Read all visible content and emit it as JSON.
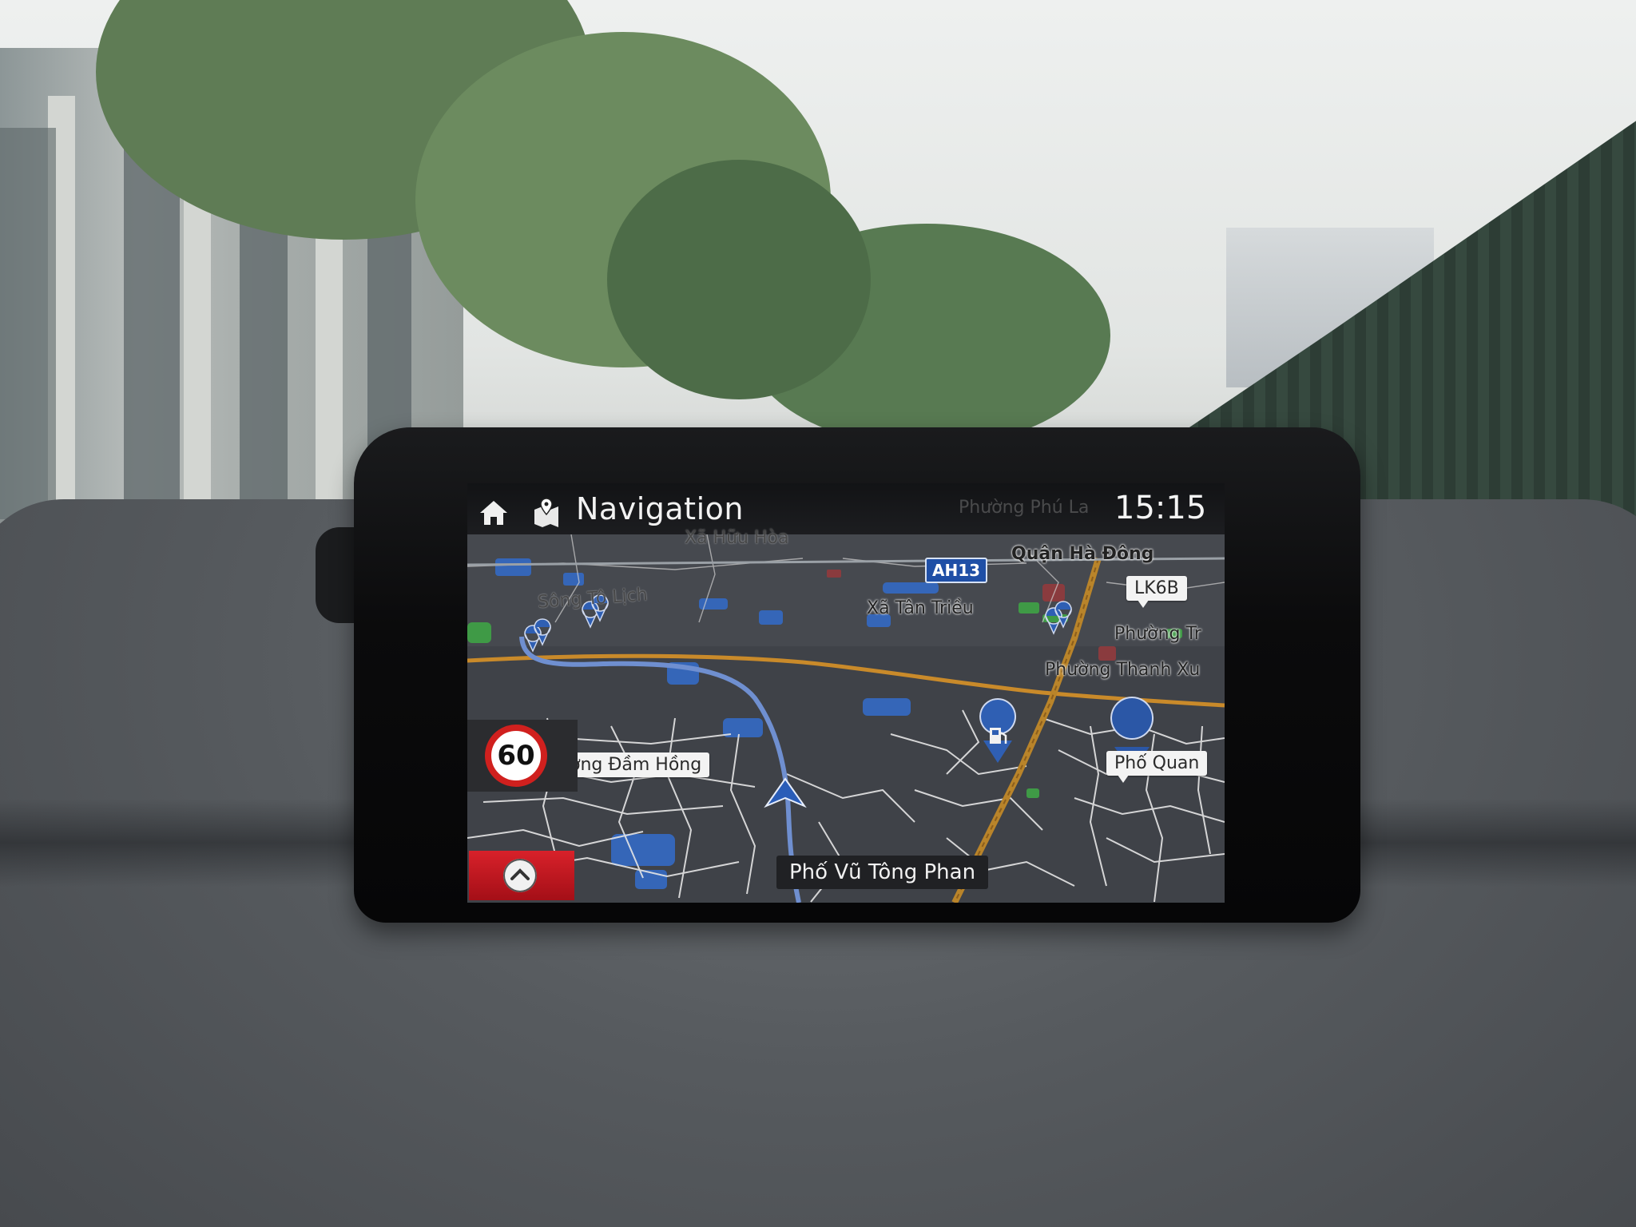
{
  "header": {
    "title": "Navigation",
    "locality_ghost": "Phường Phú La",
    "time": "15:15"
  },
  "map": {
    "labels": {
      "xa_huu_hoa": "Xã Hữu Hòa",
      "quan_ha_dong": "Quận Hà Đông",
      "xa_tan_trieu": "Xã Tân Triều",
      "song_to_lich": "Sông Tô Lịch",
      "phuong_tr": "Phường Tr",
      "phuong_thanh_xuan": "Phường Thanh Xu"
    },
    "road_shield": "AH13",
    "callouts": {
      "lk6b": "LK6B",
      "duong_dam_hong": "Đường Đầm Hồng",
      "pho_quan": "Phố Quan"
    },
    "speed_limit": "60",
    "current_street": "Phố Vũ Tông Phan"
  },
  "colors": {
    "route": "#6f8fd0",
    "highway": "#c98a2a",
    "poi": "#2f5fb3",
    "speed_ring": "#d0201e"
  },
  "icons": {
    "home": "home-icon",
    "navigation": "map-pin-icon",
    "vehicle": "vehicle-arrow-icon",
    "compass": "compass-icon",
    "fuel": "fuel-station-icon",
    "poi": "poi-pin-icon"
  }
}
